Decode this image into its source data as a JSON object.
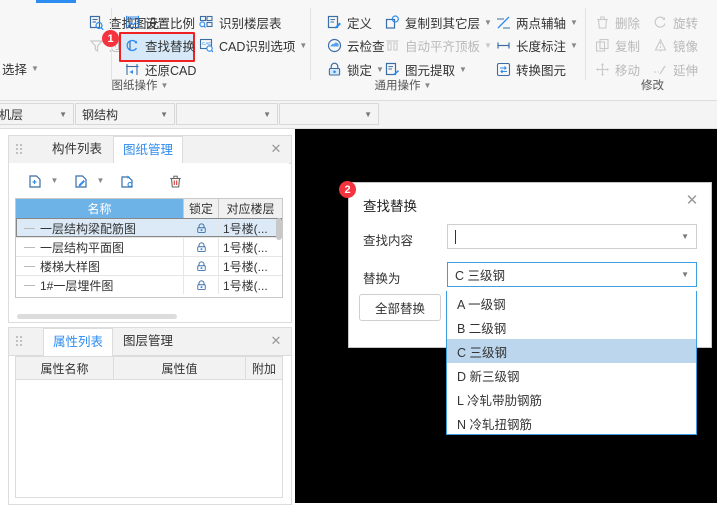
{
  "ribbon": {
    "groups": [
      {
        "label": "图纸操作",
        "items": [
          {
            "label": "查找图元",
            "icon": "find-element-icon",
            "disabled": false,
            "caret": false
          },
          {
            "label": "过滤图元",
            "icon": "filter-element-icon",
            "disabled": true,
            "caret": false
          },
          {
            "label": "选择",
            "icon": "select-icon",
            "disabled": false,
            "caret": true
          },
          {
            "label": "设置比例",
            "icon": "set-scale-icon",
            "disabled": false,
            "caret": false
          },
          {
            "label": "查找替换",
            "icon": "find-replace-icon",
            "disabled": false,
            "caret": false
          },
          {
            "label": "还原CAD",
            "icon": "restore-cad-icon",
            "disabled": false,
            "caret": false
          },
          {
            "label": "识别楼层表",
            "icon": "identify-floor-table-icon",
            "disabled": false,
            "caret": false
          },
          {
            "label": "CAD识别选项",
            "icon": "cad-identify-options-icon",
            "disabled": false,
            "caret": true
          }
        ]
      },
      {
        "label": "通用操作",
        "items": [
          {
            "label": "定义",
            "icon": "define-icon",
            "disabled": false,
            "caret": false
          },
          {
            "label": "云检查",
            "icon": "cloud-check-icon",
            "disabled": false,
            "caret": false
          },
          {
            "label": "锁定",
            "icon": "lock-icon",
            "disabled": false,
            "caret": true
          },
          {
            "label": "复制到其它层",
            "icon": "copy-to-other-layer-icon",
            "disabled": false,
            "caret": true
          },
          {
            "label": "自动平齐顶板",
            "icon": "auto-align-slab-icon",
            "disabled": true,
            "caret": true
          },
          {
            "label": "图元提取",
            "icon": "element-extract-icon",
            "disabled": false,
            "caret": true
          },
          {
            "label": "两点辅轴",
            "icon": "two-point-aux-axis-icon",
            "disabled": false,
            "caret": true
          },
          {
            "label": "长度标注",
            "icon": "length-dimension-icon",
            "disabled": false,
            "caret": true
          },
          {
            "label": "转换图元",
            "icon": "convert-element-icon",
            "disabled": false,
            "caret": false
          }
        ]
      },
      {
        "label": "修改",
        "items": [
          {
            "label": "删除",
            "icon": "delete-icon",
            "disabled": true,
            "caret": false
          },
          {
            "label": "旋转",
            "icon": "rotate-icon",
            "disabled": true,
            "caret": false
          },
          {
            "label": "复制",
            "icon": "copy-icon",
            "disabled": true,
            "caret": false
          },
          {
            "label": "镜像",
            "icon": "mirror-icon",
            "disabled": true,
            "caret": false
          },
          {
            "label": "移动",
            "icon": "move-icon",
            "disabled": true,
            "caret": false
          },
          {
            "label": "延伸",
            "icon": "extend-icon",
            "disabled": true,
            "caret": false
          }
        ]
      }
    ],
    "highlight_badge": "1"
  },
  "combobar": {
    "items": [
      {
        "value": "机层"
      },
      {
        "value": "钢结构"
      },
      {
        "value": ""
      },
      {
        "value": ""
      }
    ]
  },
  "drawing_panel": {
    "tabs": [
      {
        "label": "构件列表",
        "selected": false
      },
      {
        "label": "图纸管理",
        "selected": true
      }
    ],
    "close_label": "✕",
    "toolbar": [
      {
        "name": "add-drawing-icon"
      },
      {
        "name": "edit-drawing-icon"
      },
      {
        "name": "split-drawing-icon"
      },
      {
        "name": "delete-drawing-icon"
      }
    ],
    "table": {
      "headers": [
        "名称",
        "锁定",
        "对应楼层"
      ],
      "rows": [
        {
          "name": "一层结构梁配筋图",
          "lock": "lock-icon",
          "floor": "1号楼(...",
          "selected": true
        },
        {
          "name": "一层结构平面图",
          "lock": "lock-icon",
          "floor": "1号楼(...",
          "selected": false
        },
        {
          "name": "楼梯大样图",
          "lock": "lock-icon",
          "floor": "1号楼(...",
          "selected": false
        },
        {
          "name": "1#一层埋件图",
          "lock": "lock-icon",
          "floor": "1号楼(...",
          "selected": false
        }
      ]
    }
  },
  "property_panel": {
    "tabs": [
      {
        "label": "属性列表",
        "selected": true
      },
      {
        "label": "图层管理",
        "selected": false
      }
    ],
    "close_label": "✕",
    "headers": [
      "属性名称",
      "属性值",
      "附加"
    ],
    "rows": []
  },
  "dialog": {
    "badge": "2",
    "title": "查找替换",
    "close_label": "✕",
    "find_label": "查找内容",
    "find_value": "",
    "replace_label": "替换为",
    "replace_value": "C 三级钢",
    "replace_all_label": "全部替换"
  },
  "dropdown": {
    "options": [
      {
        "label": "A 一级钢",
        "selected": false
      },
      {
        "label": "B 二级钢",
        "selected": false
      },
      {
        "label": "C 三级钢",
        "selected": true
      },
      {
        "label": "D 新三级钢",
        "selected": false
      },
      {
        "label": "L 冷轧带肋钢筋",
        "selected": false
      },
      {
        "label": "N 冷轧扭钢筋",
        "selected": false
      }
    ]
  },
  "colors": {
    "accent": "#2d8cf0",
    "header_blue": "#6eb3e8",
    "badge_red": "#f5333f",
    "highlight_red": "#ee2222",
    "select_blue": "#bcd6ee",
    "canvas_black": "#000000"
  }
}
